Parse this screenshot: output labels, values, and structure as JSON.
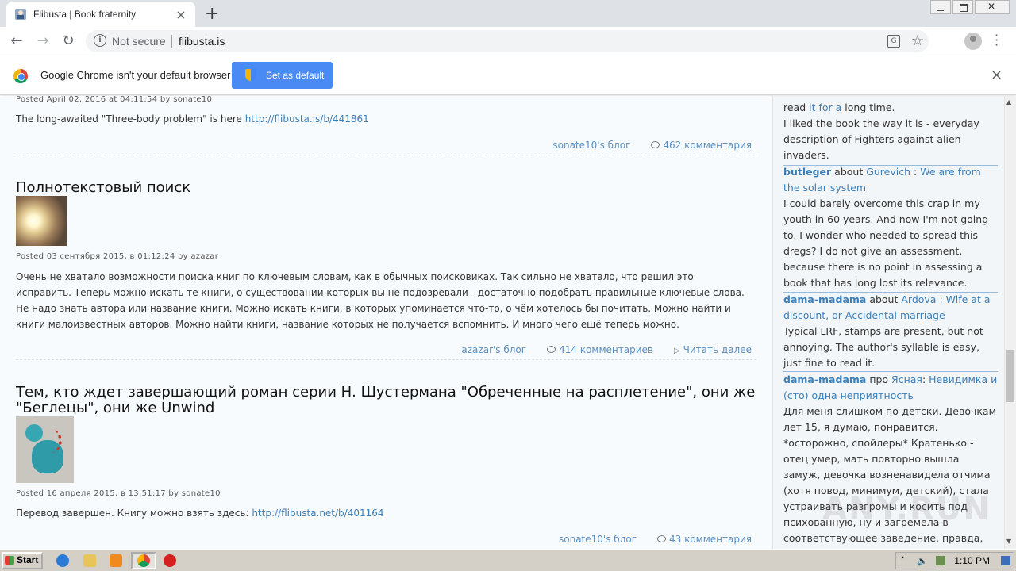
{
  "browser": {
    "tab_title": "Flibusta | Book fraternity",
    "tab_close": "×",
    "new_tab": "+",
    "not_secure": "Not secure",
    "url": "flibusta.is"
  },
  "infobar": {
    "message": "Google Chrome isn't your default browser",
    "button": "Set as default",
    "close": "×"
  },
  "posts": [
    {
      "meta": "Posted April 02, 2016 at 04:11:54 by sonate10",
      "text_prefix": "The long-awaited \"Three-body problem\" is here ",
      "link": "http://flibusta.is/b/441861",
      "blog": "sonate10's блог",
      "comments": "462 комментария"
    },
    {
      "title": "Полнотекстовый поиск",
      "meta": "Posted 03 сентября 2015, в 01:12:24 by azazar",
      "text": "Очень не хватало возможности поиска книг по ключевым словам, как в обычных поисковиках. Так сильно не хватало, что решил это исправить. Теперь можно искать те книги, о существовании которых вы не подозревали - достаточно подобрать правильные ключевые слова. Не надо знать автора или название книги. Можно искать книги, в которых упоминается что-то, о чём хотелось бы почитать. Можно найти и книги малоизвестных авторов. Можно найти книги, название которых не получается вспомнить. И много чего ещё теперь можно.",
      "blog": "azazar's блог",
      "comments": "414 комментариев",
      "read_more": "Читать далее"
    },
    {
      "title": "Тем, кто ждет завершающий роман серии Н. Шустермана \"Обреченные на расплетение\", они же \"Беглецы\", они же Unwind",
      "meta": "Posted 16 апреля 2015, в 13:51:17 by sonate10",
      "text_prefix": "Перевод завершен. Книгу можно взять здесь: ",
      "link": "http://flibusta.net/b/401164",
      "blog": "sonate10's блог",
      "comments": "43 комментария"
    }
  ],
  "sidebar": {
    "c1_line1_pre": "read ",
    "c1_line1_link": "it for a",
    "c1_line1_post": " long time.",
    "c1_body": "I liked the book the way it is - everyday description of Fighters against alien invaders.",
    "c2_user": "butleger",
    "c2_about": " about ",
    "c2_author": "Gurevich",
    "c2_colon": " : ",
    "c2_book": "We are from the solar system",
    "c2_body": "I could barely overcome this crap in my youth in 60 years. And now I'm not going to. I wonder who needed to spread this dregs? I do not give an assessment, because there is no point in assessing a book that has long lost its relevance.",
    "c3_user": "dama-madama",
    "c3_about": " about ",
    "c3_author": "Ardova",
    "c3_colon": " : ",
    "c3_book": "Wife at a discount, or Accidental marriage",
    "c3_body": "Typical LRF, stamps are present, but not annoying. The author's syllable is easy, just fine to read it.",
    "c4_user": "dama-madama",
    "c4_about": " про ",
    "c4_author": "Ясная",
    "c4_colon": ": ",
    "c4_book": "Невидимка и (сто) одна неприятность",
    "c4_body": "Для меня слишком по-детски. Девочкам лет 15, я думаю, понравится. *осторожно, спойлеры* Кратенько - отец умер, мать повторно вышла замуж, девочка возненавидела отчима (хотя повод, минимум, детский), стала устраивать разгромы и косить под психованную, ну и загремела в соответствующее заведение, правда,"
  },
  "watermark": "ANY.RUN",
  "taskbar": {
    "start": "Start",
    "clock": "1:10 PM"
  }
}
